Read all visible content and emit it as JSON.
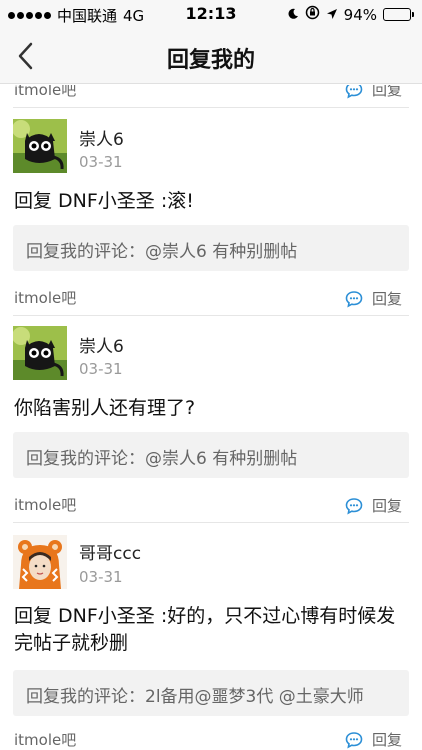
{
  "status_bar": {
    "carrier": "中国联通",
    "network": "4G",
    "time": "12:13",
    "battery": "94%",
    "battery_level": 0.94
  },
  "nav": {
    "title": "回复我的"
  },
  "feed": {
    "top_partial": {
      "forum": "itmole吧",
      "reply_label": "回复"
    },
    "cards": [
      {
        "username": "崇人6",
        "date": "03-31",
        "reply_text": "回复 DNF小圣圣 :滚!",
        "quote": "回复我的评论：@崇人6 有种别删帖",
        "forum": "itmole吧",
        "reply_label": "回复"
      },
      {
        "username": "崇人6",
        "date": "03-31",
        "reply_text": "你陷害别人还有理了?",
        "quote": "回复我的评论：@崇人6 有种别删帖",
        "forum": "itmole吧",
        "reply_label": "回复"
      },
      {
        "username": "哥哥ccc",
        "date": "03-31",
        "reply_text": "回复 DNF小圣圣 :好的，只不过心博有时候发完帖子就秒删",
        "quote": "回复我的评论：2l备用@噩梦3代 @土豪大师",
        "forum": "itmole吧",
        "reply_label": "回复"
      }
    ]
  }
}
